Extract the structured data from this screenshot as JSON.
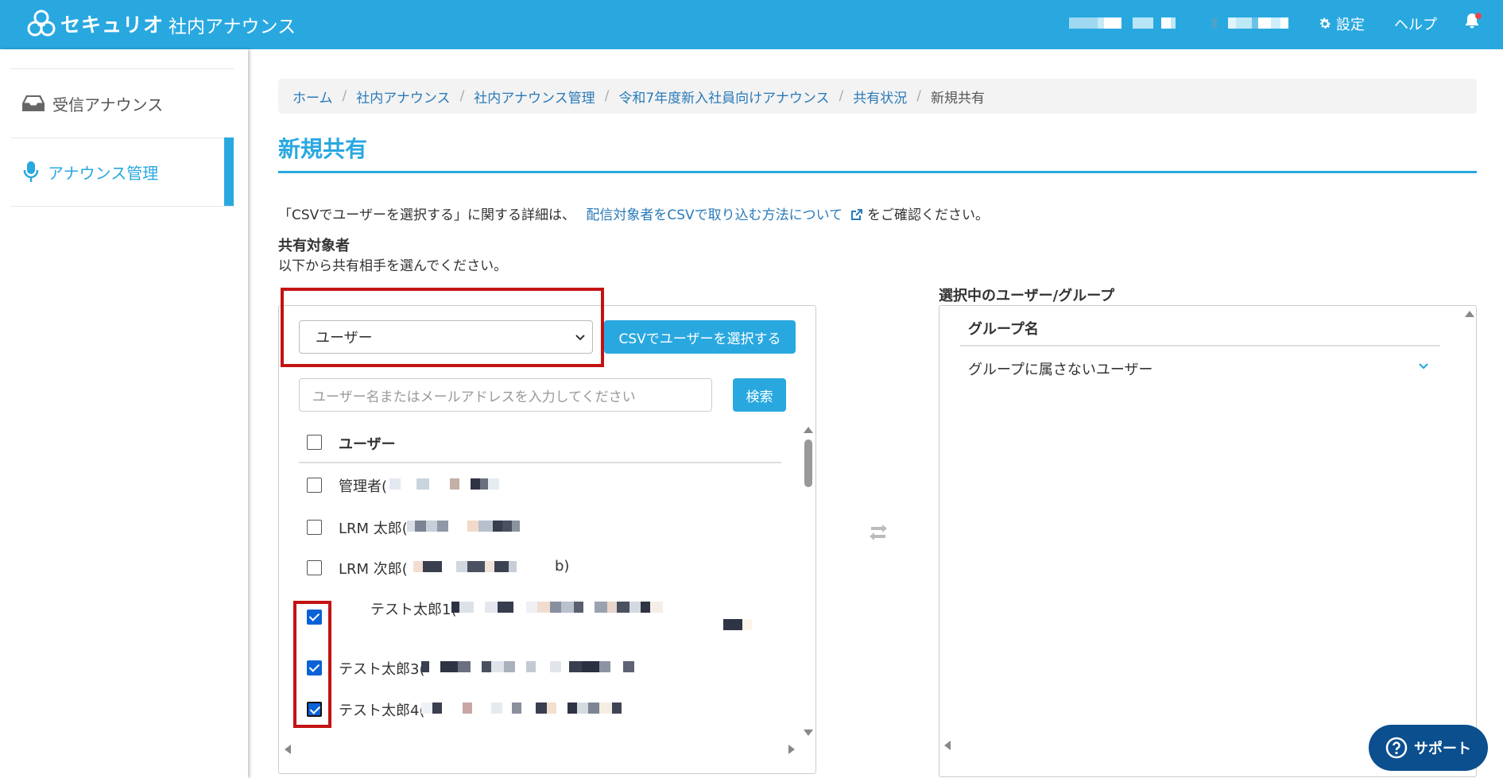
{
  "header": {
    "brand": "セキュリオ",
    "app_name": "社内アナウンス",
    "settings_label": "設定",
    "help_label": "ヘルプ"
  },
  "sidebar": {
    "items": [
      {
        "label": "受信アナウンス",
        "icon": "inbox-icon",
        "active": false
      },
      {
        "label": "アナウンス管理",
        "icon": "microphone-icon",
        "active": true
      }
    ]
  },
  "breadcrumb": [
    "ホーム",
    "社内アナウンス",
    "社内アナウンス管理",
    "令和7年度新入社員向けアナウンス",
    "共有状況",
    "新規共有"
  ],
  "page": {
    "title": "新規共有",
    "note_prefix": "「CSVでユーザーを選択する」に関する詳細は、",
    "note_link": "配信対象者をCSVで取り込む方法について",
    "note_suffix": "をご確認ください。",
    "target_heading": "共有対象者",
    "target_sub": "以下から共有相手を選んでください。"
  },
  "left_panel": {
    "select_value": "ユーザー",
    "csv_button": "CSVでユーザーを選択する",
    "search_placeholder": "ユーザー名またはメールアドレスを入力してください",
    "search_button": "検索",
    "column_header": "ユーザー",
    "users": [
      {
        "name": "管理者(",
        "checked": false
      },
      {
        "name": "LRM 太郎(",
        "checked": false
      },
      {
        "name": "LRM 次郎(",
        "checked": false
      },
      {
        "name": "テスト太郎1(",
        "checked": true
      },
      {
        "name": "テスト太郎3(",
        "checked": true
      },
      {
        "name": "テスト太郎4(",
        "checked": true
      }
    ]
  },
  "right_panel": {
    "heading": "選択中のユーザー/グループ",
    "group_header": "グループ名",
    "groups": [
      "グループに属さないユーザー"
    ]
  },
  "support_label": "サポート",
  "colors": {
    "accent": "#29a8e0",
    "link": "#2a7ab8",
    "highlight_red": "#c41212",
    "support_bg": "#0b4f8f",
    "checkbox_blue": "#0a63d6"
  }
}
